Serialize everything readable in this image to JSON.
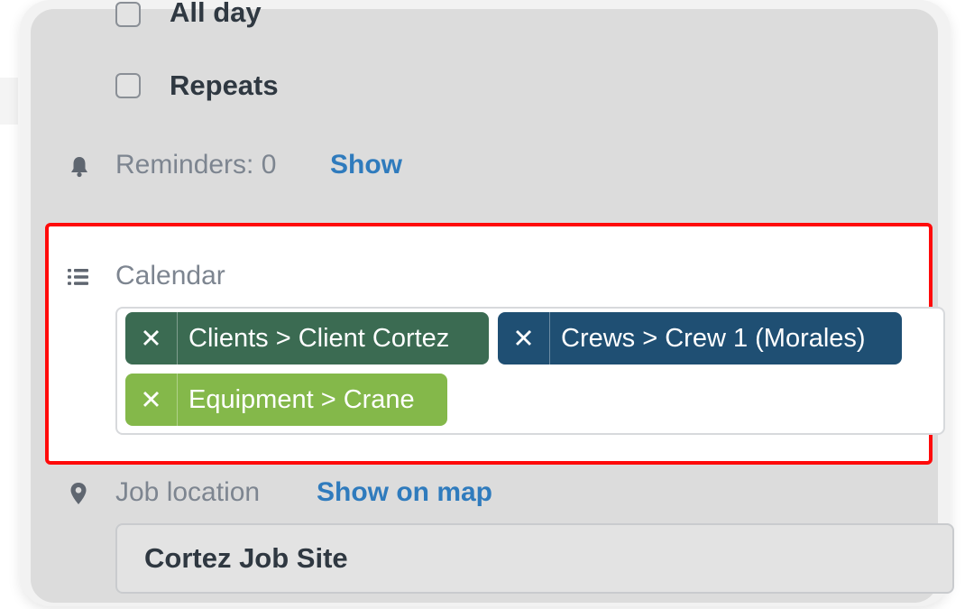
{
  "form": {
    "all_day": {
      "label": "All day",
      "checked": false
    },
    "repeats": {
      "label": "Repeats",
      "checked": false
    },
    "reminders": {
      "label": "Reminders: 0",
      "link": "Show",
      "icon": "bell-icon"
    },
    "calendar": {
      "label": "Calendar",
      "icon": "list-icon",
      "tags": [
        {
          "text": "Clients > Client Cortez",
          "remove": "✕",
          "color": "#3b6b52"
        },
        {
          "text": "Crews > Crew 1 (Morales)",
          "remove": "✕",
          "color": "#1f4f73"
        },
        {
          "text": "Equipment > Crane",
          "remove": "✕",
          "color": "#84b84a"
        }
      ]
    },
    "job_location": {
      "label": "Job location",
      "link": "Show on map",
      "icon": "map-pin-icon",
      "value": "Cortez Job Site"
    }
  },
  "colors": {
    "link": "#2f7bbd",
    "highlight_border": "#ff0a0a"
  }
}
